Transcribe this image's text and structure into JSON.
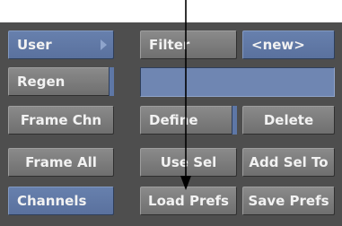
{
  "buttons": {
    "user": "User",
    "regen": "Regen",
    "frame_chn": "Frame Chn",
    "frame_all": "Frame All",
    "channels": "Channels",
    "filter": "Filter",
    "new_value": "<new>",
    "define": "Define",
    "delete": "Delete",
    "use_sel": "Use Sel",
    "add_sel_to": "Add Sel To",
    "load_prefs": "Load Prefs",
    "save_prefs": "Save Prefs"
  },
  "icons": {
    "user_dropdown": "triangle-right-icon",
    "callout": "arrow-down-icon"
  },
  "colors": {
    "panel": "#4e4e4e",
    "button_gray": "#7c7c7c",
    "button_blue": "#6078a8",
    "field_blue": "#6f86b2",
    "text": "#f2f2f2",
    "callout": "#000000"
  }
}
